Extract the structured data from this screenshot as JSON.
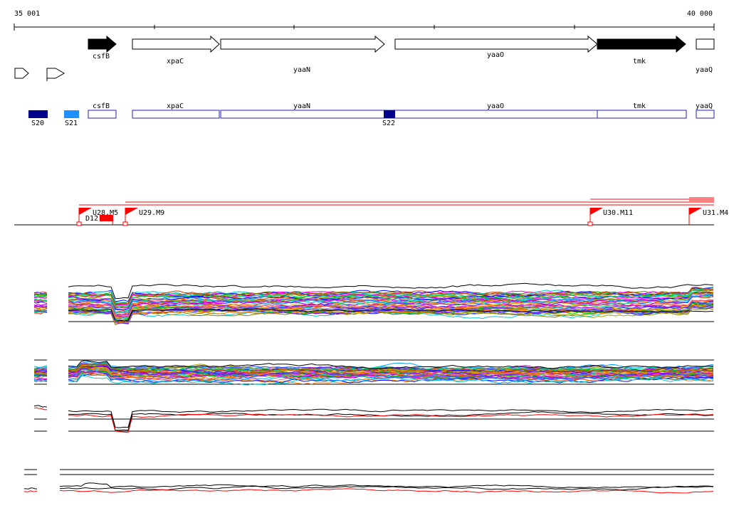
{
  "ruler": {
    "start_label": "35 001",
    "end_label": "40 000"
  },
  "genes": [
    {
      "name": "csfB",
      "strand": "+",
      "filled": true
    },
    {
      "name": "xpaC",
      "strand": "+",
      "filled": false
    },
    {
      "name": "yaaN",
      "strand": "+",
      "filled": false
    },
    {
      "name": "yaaO",
      "strand": "+",
      "filled": false
    },
    {
      "name": "tmk",
      "strand": "+",
      "filled": true
    },
    {
      "name": "yaaQ",
      "strand": "+",
      "filled": false
    }
  ],
  "transcript_track": {
    "labels": [
      "csfB",
      "xpaC",
      "yaaN",
      "yaaO",
      "tmk",
      "yaaQ"
    ]
  },
  "sites": [
    {
      "name": "S20",
      "color": "#00008b"
    },
    {
      "name": "S21",
      "color": "#1e90ff"
    },
    {
      "name": "S22",
      "color": "#00008b"
    }
  ],
  "upshifts": [
    "U28.M5",
    "U29.M9",
    "U30.M11",
    "U31.M4"
  ],
  "downshift": "D12",
  "colors": {
    "red": "#ff0000",
    "blue_outline": "#2020c0",
    "black": "#000000"
  },
  "expression_palette": [
    "#ff00ff",
    "#00c000",
    "#ffa500",
    "#0000ff",
    "#00c8c8",
    "#c000c0",
    "#808000",
    "#ff6060",
    "#00a0ff",
    "#a0a000",
    "#8000ff",
    "#ff8000",
    "#00e080",
    "#c04000",
    "#4040ff"
  ]
}
